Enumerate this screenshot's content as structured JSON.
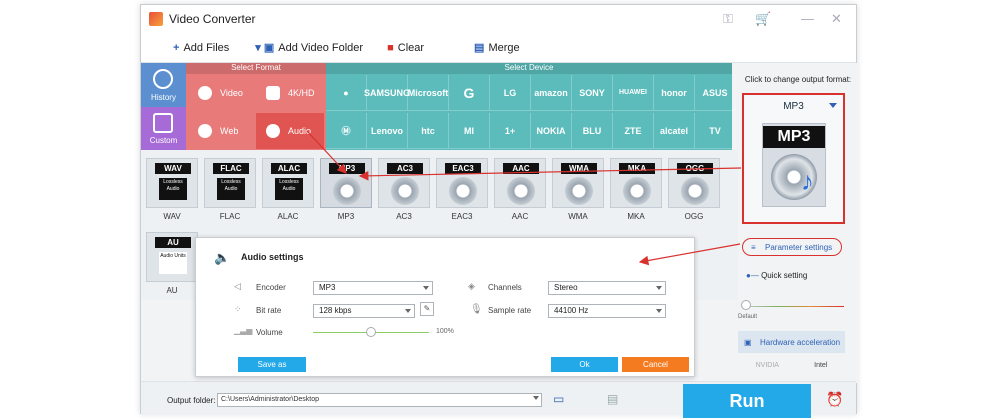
{
  "window": {
    "title": "Video Converter",
    "controls": [
      "⚿",
      "🛒",
      "—",
      "✕"
    ]
  },
  "toolbar": {
    "add_files": "Add Files",
    "add_folder": "Add Video Folder",
    "clear": "Clear",
    "merge": "Merge"
  },
  "left_tiles": {
    "history": "History",
    "custom": "Custom"
  },
  "format_panel": {
    "header": "Select Format",
    "items": [
      "Video",
      "4K/HD",
      "Web",
      "Audio"
    ]
  },
  "device_panel": {
    "header": "Select Device",
    "row1": [
      "",
      "SAMSUNG",
      "Microsoft",
      "G",
      "LG",
      "amazon",
      "SONY",
      "HUAWEI",
      "honor",
      "ASUS"
    ],
    "row2": [
      "",
      "Lenovo",
      "htc",
      "MI",
      "1+",
      "NOKIA",
      "BLU",
      "ZTE",
      "alcatel",
      "TV"
    ]
  },
  "right_panel": {
    "prompt": "Click to change output format:",
    "selected_format": "MP3",
    "art_label": "MP3",
    "parameter_settings": "Parameter settings",
    "quick_setting": "Quick setting",
    "default_label": "Default",
    "hardware_acceleration": "Hardware acceleration",
    "gpu1": "NVIDIA",
    "gpu2": "Intel"
  },
  "formats": [
    {
      "tag": "WAV",
      "sub": "Lossless Audio",
      "name": "WAV"
    },
    {
      "tag": "FLAC",
      "sub": "Lossless Audio",
      "name": "FLAC"
    },
    {
      "tag": "ALAC",
      "sub": "Lossless Audio",
      "name": "ALAC"
    },
    {
      "tag": "MP3",
      "sub": "",
      "name": "MP3"
    },
    {
      "tag": "AC3",
      "sub": "",
      "name": "AC3"
    },
    {
      "tag": "EAC3",
      "sub": "",
      "name": "EAC3"
    },
    {
      "tag": "AAC",
      "sub": "",
      "name": "AAC"
    },
    {
      "tag": "WMA",
      "sub": "",
      "name": "WMA"
    },
    {
      "tag": "MKA",
      "sub": "",
      "name": "MKA"
    },
    {
      "tag": "OGG",
      "sub": "",
      "name": "OGG"
    },
    {
      "tag": "AU",
      "sub": "Audio Units",
      "name": "AU"
    }
  ],
  "audio_settings": {
    "title": "Audio settings",
    "encoder_label": "Encoder",
    "encoder_value": "MP3",
    "bitrate_label": "Bit rate",
    "bitrate_value": "128 kbps",
    "volume_label": "Volume",
    "volume_value": "100%",
    "volume_level": 0.5,
    "channels_label": "Channels",
    "channels_value": "Stereo",
    "samplerate_label": "Sample rate",
    "samplerate_value": "44100 Hz",
    "save_as": "Save as",
    "ok": "Ok",
    "cancel": "Cancel"
  },
  "bottom": {
    "output_label": "Output folder:",
    "output_path": "C:\\Users\\Administrator\\Desktop",
    "run": "Run"
  },
  "colors": {
    "accent_red": "#d9312d",
    "run_blue": "#23a8e8",
    "format_pink": "#e97a7a",
    "device_teal": "#5cbcbc"
  }
}
